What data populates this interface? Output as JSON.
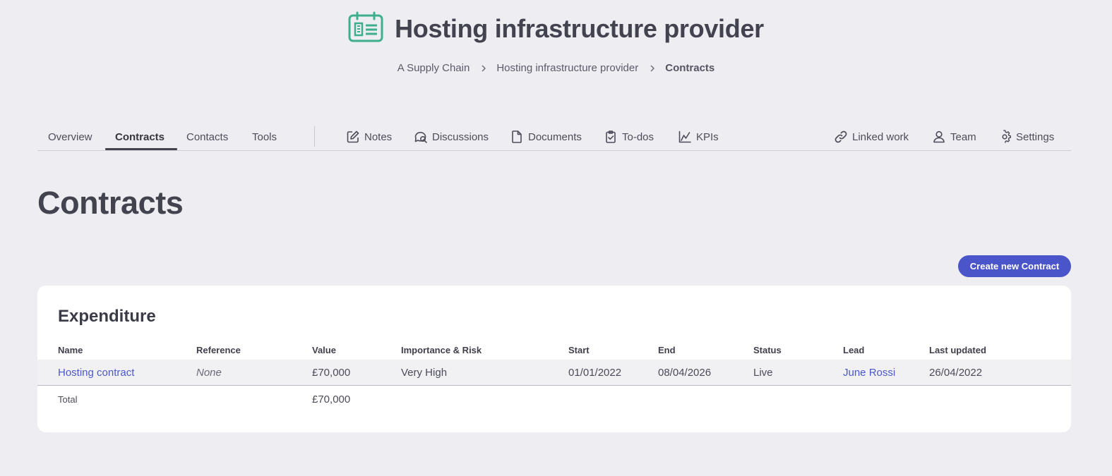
{
  "header": {
    "title": "Hosting infrastructure provider",
    "icon": "supplier-calendar-icon",
    "icon_color": "#3fae8f",
    "breadcrumb": [
      {
        "label": "A Supply Chain"
      },
      {
        "label": "Hosting infrastructure provider"
      },
      {
        "label": "Contracts"
      }
    ]
  },
  "tabs": {
    "primary": [
      "Overview",
      "Contracts",
      "Contacts",
      "Tools"
    ],
    "active": "Contracts",
    "secondary": [
      {
        "label": "Notes",
        "icon": "edit-icon"
      },
      {
        "label": "Discussions",
        "icon": "discussions-icon"
      },
      {
        "label": "Documents",
        "icon": "document-icon"
      },
      {
        "label": "To-dos",
        "icon": "clipboard-check-icon"
      },
      {
        "label": "KPIs",
        "icon": "chart-line-icon"
      }
    ],
    "right": [
      {
        "label": "Linked work",
        "icon": "link-icon"
      },
      {
        "label": "Team",
        "icon": "user-icon"
      },
      {
        "label": "Settings",
        "icon": "gear-icon"
      }
    ]
  },
  "main": {
    "title": "Contracts",
    "create_button": "Create new Contract",
    "accent_color": "#4a55c9"
  },
  "table": {
    "title": "Expenditure",
    "columns": [
      "Name",
      "Reference",
      "Value",
      "Importance & Risk",
      "Start",
      "End",
      "Status",
      "Lead",
      "Last updated"
    ],
    "rows": [
      {
        "name": "Hosting contract",
        "reference": "None",
        "value": "£70,000",
        "importance_risk": "Very High",
        "start": "01/01/2022",
        "end": "08/04/2026",
        "status": "Live",
        "lead": "June Rossi",
        "last_updated": "26/04/2022"
      }
    ],
    "total": {
      "label": "Total",
      "value": "£70,000"
    }
  }
}
